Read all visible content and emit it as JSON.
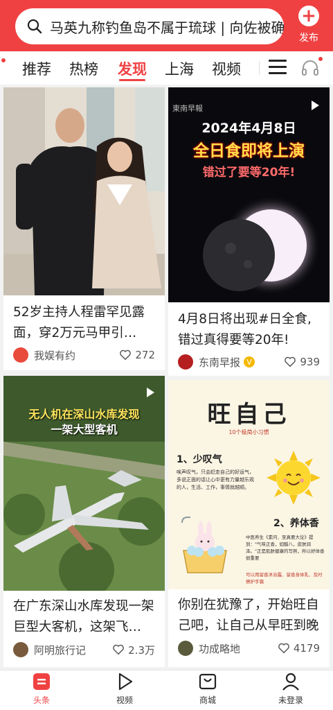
{
  "header": {
    "search_text": "马英九称钓鱼岛不属于琉球 | 向佐被确",
    "publish_label": "发布",
    "accent": "#f04142"
  },
  "tabs": [
    {
      "label": "推荐",
      "active": false
    },
    {
      "label": "热榜",
      "active": false
    },
    {
      "label": "发现",
      "active": true
    },
    {
      "label": "上海",
      "active": false
    },
    {
      "label": "视频",
      "active": false
    }
  ],
  "feed": [
    {
      "title_line1": "52岁主持人程雷罕见露",
      "title_line2": "面，穿2万元马甲引…",
      "author": "我娱有约",
      "likes": "272",
      "verified": false,
      "is_video": false
    },
    {
      "overlay_source": "東南早報",
      "overlay_date": "2024年4月8日",
      "overlay_headline": "全日食即将上演",
      "overlay_sub": "错过了要等20年!",
      "title_line1": "4月8日将出现#日全食,",
      "title_line2": "错过真得要等20年!",
      "author": "东南早报",
      "likes": "939",
      "verified": true,
      "is_video": true
    },
    {
      "overlay_line1": "无人机在深山水库发现",
      "overlay_line2": "一架大型客机",
      "title_line1": "在广东深山水库发现一架",
      "title_line2": "巨型大客机，这架飞…",
      "author": "阿明旅行记",
      "likes": "2.3万",
      "verified": false,
      "is_video": true
    },
    {
      "poster_title": "旺自己",
      "poster_subtitle": "10个极简小习惯",
      "poster_item1_title": "1、少叹气",
      "poster_item1_text": "唉声叹气，只会赶走自己的好运气，多说正面的话让心中更有力量越乐观的人，生活、工作，事情就越顺。",
      "poster_item2_title": "2、养体香",
      "poster_item2_text": "中医养生《素问．至真要大论》提到：\"气味正香，如醋八，皮肤润泽。\"正是肌肤健康的写照，所以好体香很重要",
      "poster_item2_note": "可以用留香沐浴露、留香身体乳、及时擦护手霜",
      "title_line1": "你别在犹豫了，开始旺自",
      "title_line2": "己吧，让自己从早旺到晚",
      "author": "功成略地",
      "likes": "4179",
      "verified": false,
      "is_video": false
    }
  ],
  "bottom_nav": [
    {
      "label": "头条",
      "icon": "home-icon",
      "active": true
    },
    {
      "label": "视频",
      "icon": "play-icon",
      "active": false
    },
    {
      "label": "商城",
      "icon": "shop-icon",
      "active": false
    },
    {
      "label": "未登录",
      "icon": "person-icon",
      "active": false
    }
  ]
}
